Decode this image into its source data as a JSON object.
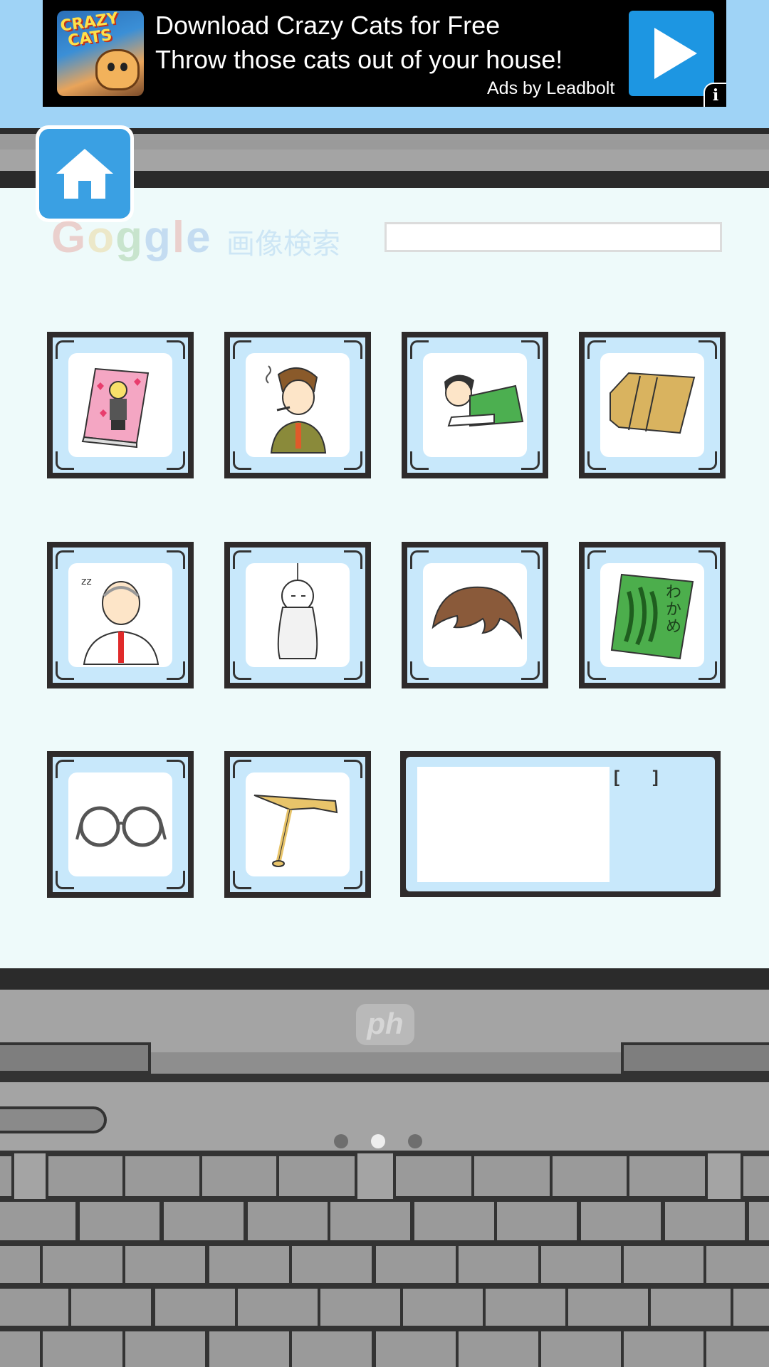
{
  "ad": {
    "line1": "Download Crazy Cats for Free",
    "line2": "Throw those cats out of your house!",
    "attribution": "Ads by Leadbolt",
    "thumbnail_text": "CRAZY CATS",
    "info_label": "i",
    "play_color": "#1d96e2"
  },
  "header": {
    "home_icon": "home-icon",
    "logo_letters": [
      "G",
      "o",
      "g",
      "g",
      "l",
      "e"
    ],
    "logo_colors": [
      "#e2564b",
      "#e9b43a",
      "#5aa64a",
      "#4a86d8",
      "#e2564b",
      "#4a86d8"
    ],
    "search_label": "画像検索",
    "search_value": ""
  },
  "items": [
    {
      "name": "romance-book-icon"
    },
    {
      "name": "smoking-man-icon"
    },
    {
      "name": "lying-woman-icon"
    },
    {
      "name": "cardboard-box-icon"
    },
    {
      "name": "sleepy-old-man-icon"
    },
    {
      "name": "teru-teru-bozu-icon"
    },
    {
      "name": "wig-hair-icon"
    },
    {
      "name": "wakame-seaweed-icon"
    },
    {
      "name": "glasses-icon"
    },
    {
      "name": "bamboo-copter-icon"
    }
  ],
  "wakame_label": "わかめ",
  "detail": {
    "brackets": "[ ]"
  },
  "footer": {
    "brand": "ph",
    "pager": {
      "pages": 3,
      "current": 2
    }
  },
  "colors": {
    "screen_bg": "#eefafa",
    "tile_mat": "#c8e8fb",
    "home_button": "#3aa0e3",
    "top_band": "#9fd3f6"
  }
}
